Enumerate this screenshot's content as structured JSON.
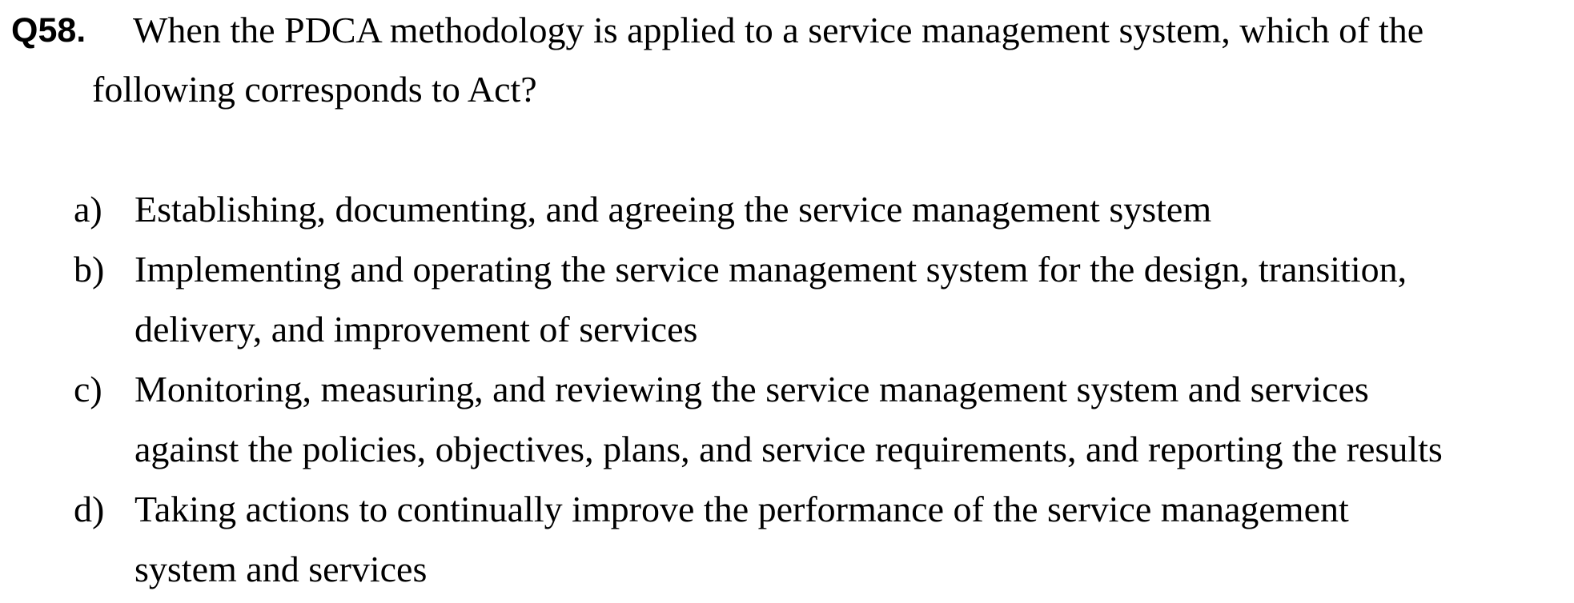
{
  "question": {
    "number": "Q58.",
    "line1": "When the PDCA methodology is applied to a service management system, which of the",
    "line2": "following corresponds to Act?"
  },
  "options": [
    {
      "letter": "a)",
      "lines": [
        "Establishing, documenting, and agreeing the service management system"
      ]
    },
    {
      "letter": "b)",
      "lines": [
        "Implementing and operating the service management system for the design, transition,",
        "delivery, and improvement of services"
      ]
    },
    {
      "letter": "c)",
      "lines": [
        "Monitoring, measuring, and reviewing the service management system and services",
        "against the policies, objectives, plans, and service requirements, and reporting the results"
      ]
    },
    {
      "letter": "d)",
      "lines": [
        "Taking actions to continually improve the performance of the service management",
        "system and services"
      ]
    }
  ]
}
